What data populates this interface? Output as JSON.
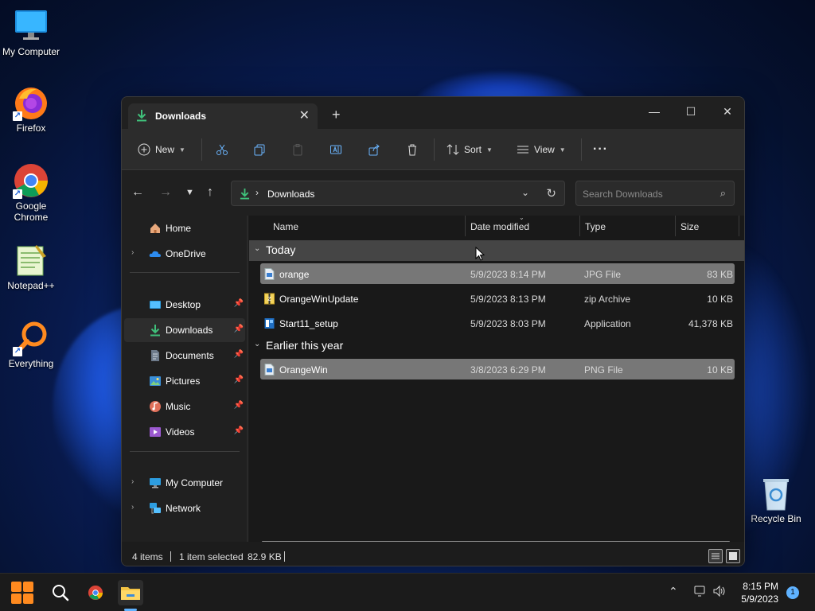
{
  "desktop": {
    "icons": [
      {
        "label": "My Computer",
        "icon": "monitor-icon"
      },
      {
        "label": "Firefox",
        "icon": "firefox-icon"
      },
      {
        "label": "Google Chrome",
        "icon": "chrome-icon"
      },
      {
        "label": "Notepad++",
        "icon": "notepadpp-icon"
      },
      {
        "label": "Everything",
        "icon": "everything-icon"
      },
      {
        "label": "Recycle Bin",
        "icon": "recycle-bin-icon"
      }
    ]
  },
  "window": {
    "tab_title": "Downloads",
    "new_tab_glyph": "+",
    "close_tab_glyph": "✕",
    "controls": {
      "minimize": "—",
      "maximize": "☐",
      "close": "✕"
    }
  },
  "toolbar": {
    "new_label": "New",
    "sort_label": "Sort",
    "view_label": "View",
    "more_glyph": "···"
  },
  "address": {
    "path": "Downloads",
    "search_placeholder": "Search Downloads"
  },
  "sidebar": {
    "top": [
      {
        "label": "Home",
        "expandable": false
      },
      {
        "label": "OneDrive",
        "expandable": true
      }
    ],
    "quick": [
      {
        "label": "Desktop",
        "pinned": true,
        "active": false
      },
      {
        "label": "Downloads",
        "pinned": true,
        "active": true
      },
      {
        "label": "Documents",
        "pinned": true,
        "active": false
      },
      {
        "label": "Pictures",
        "pinned": true,
        "active": false
      },
      {
        "label": "Music",
        "pinned": true,
        "active": false
      },
      {
        "label": "Videos",
        "pinned": true,
        "active": false
      }
    ],
    "bottom": [
      {
        "label": "My Computer",
        "expandable": true
      },
      {
        "label": "Network",
        "expandable": true
      }
    ]
  },
  "columns": {
    "name": "Name",
    "date": "Date modified",
    "type": "Type",
    "size": "Size"
  },
  "groups": [
    {
      "label": "Today",
      "files": [
        {
          "name": "orange",
          "date": "5/9/2023 8:14 PM",
          "type": "JPG File",
          "size": "83 KB",
          "selected": true,
          "icon": "jpg-file-icon"
        },
        {
          "name": "OrangeWinUpdate",
          "date": "5/9/2023 8:13 PM",
          "type": "zip Archive",
          "size": "10 KB",
          "selected": false,
          "icon": "zip-file-icon"
        },
        {
          "name": "Start11_setup",
          "date": "5/9/2023 8:03 PM",
          "type": "Application",
          "size": "41,378 KB",
          "selected": false,
          "icon": "installer-icon"
        }
      ]
    },
    {
      "label": "Earlier this year",
      "files": [
        {
          "name": "OrangeWin",
          "date": "3/8/2023 6:29 PM",
          "type": "PNG File",
          "size": "10 KB",
          "selected": false,
          "icon": "png-file-icon"
        }
      ]
    }
  ],
  "status": {
    "item_count": "4 items",
    "selection": "1 item selected",
    "selection_size": "82.9 KB"
  },
  "taskbar": {
    "time": "8:15 PM",
    "date": "5/9/2023",
    "notification_count": "1"
  },
  "colors": {
    "accent": "#5fb2ff",
    "download_green": "#3fc07a",
    "window_bg": "#1c1c1c",
    "toolbar_bg": "#2c2c2c"
  }
}
